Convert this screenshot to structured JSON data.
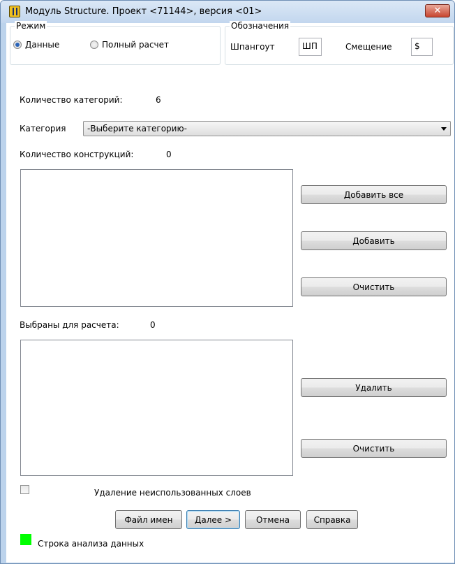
{
  "window": {
    "title": "Модуль Structure.  Проект <71144>, версия <01>",
    "close_glyph": "✕"
  },
  "mode_group": {
    "legend": "Режим",
    "options": [
      {
        "label": "Данные",
        "checked": true
      },
      {
        "label": "Полный расчет",
        "checked": false
      }
    ]
  },
  "notation_group": {
    "legend": "Обозначения",
    "frame_label": "Шпангоут",
    "frame_value": "ШП",
    "offset_label": "Смещение",
    "offset_value": "$"
  },
  "categories_count": {
    "label": "Количество категорий:",
    "value": "6"
  },
  "category": {
    "label": "Категория",
    "selected": "-Выберите категорию-"
  },
  "constructions_count": {
    "label": "Количество конструкций:",
    "value": "0"
  },
  "constructions_buttons": {
    "add_all": "Добавить все",
    "add": "Добавить",
    "clear": "Очистить"
  },
  "selected_count": {
    "label": "Выбраны для расчета:",
    "value": "0"
  },
  "selected_buttons": {
    "remove": "Удалить",
    "clear": "Очистить"
  },
  "remove_unused_layers": {
    "label": "Удаление неиспользованных слоев",
    "checked": false
  },
  "footer_buttons": {
    "file_names": "Файл имен",
    "next": "Далее >",
    "cancel": "Отмена",
    "help": "Справка"
  },
  "status": {
    "text": "Строка анализа данных",
    "color": "#00ff00"
  },
  "colors": {
    "title_bar": "#c2d6ee",
    "close_button": "#c7452f",
    "status_indicator": "#00ff00"
  }
}
